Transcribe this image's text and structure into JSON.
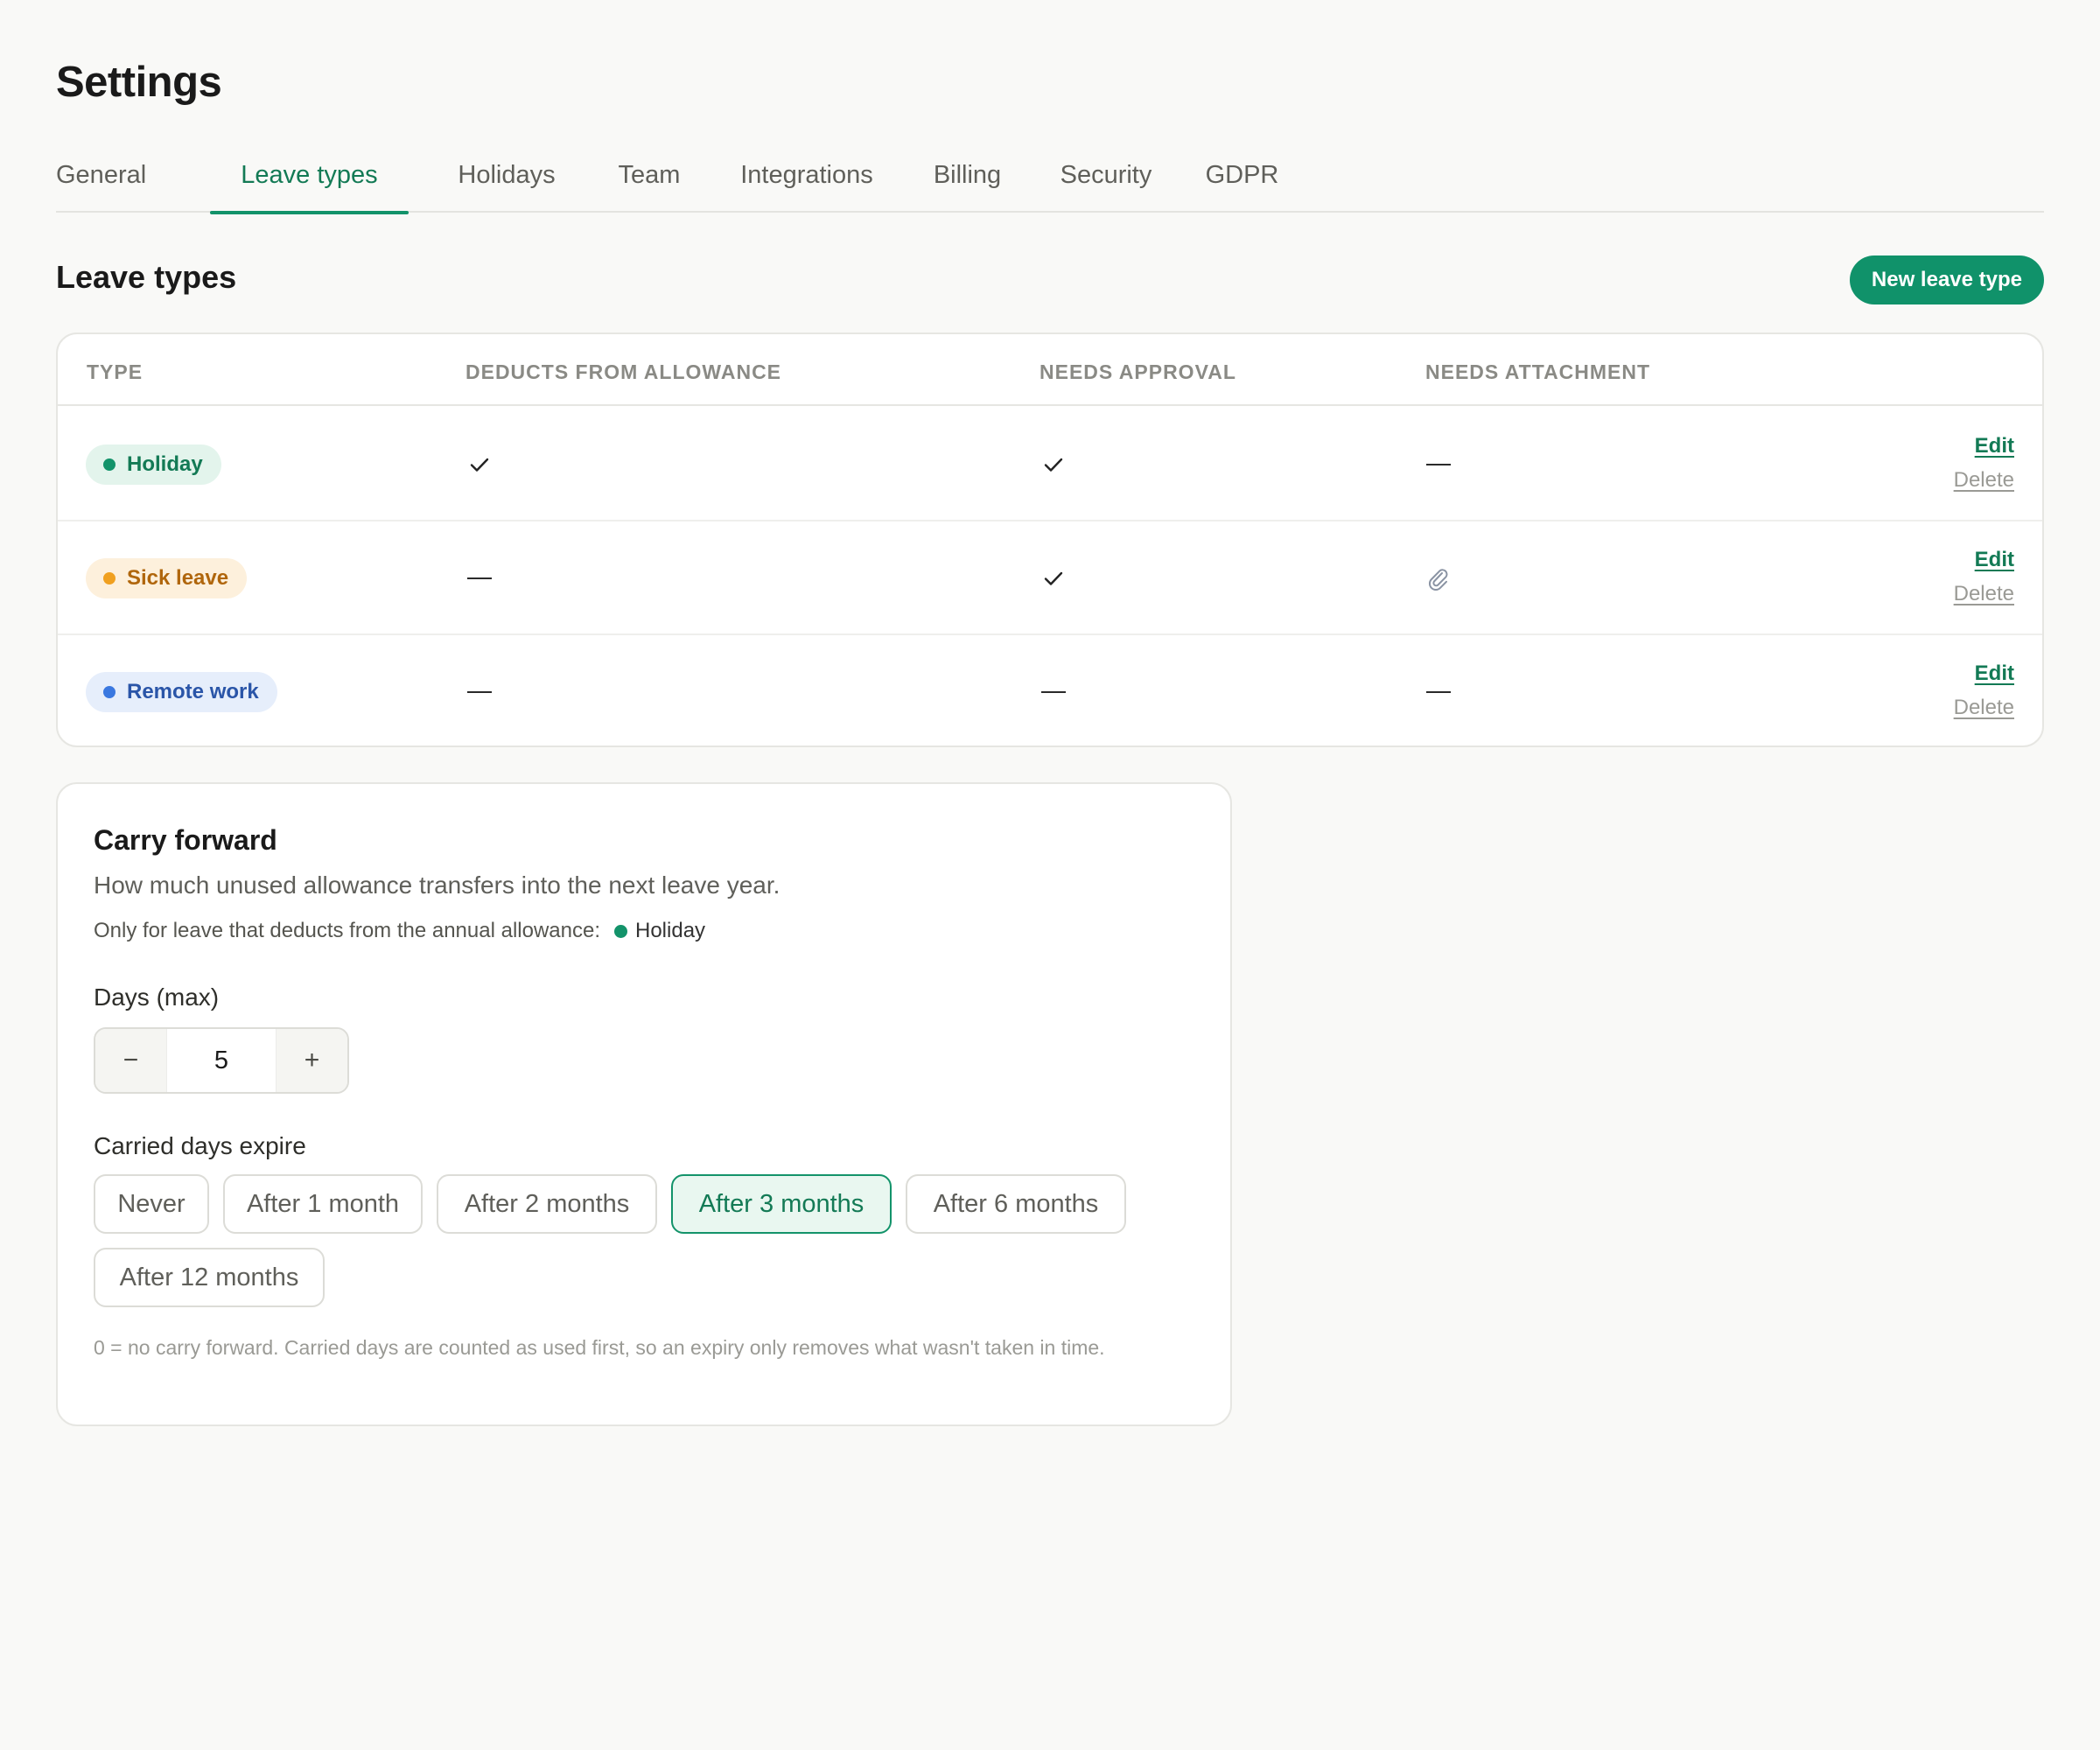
{
  "page": {
    "title": "Settings"
  },
  "tabs": [
    {
      "label": "General",
      "active": false
    },
    {
      "label": "Leave types",
      "active": true
    },
    {
      "label": "Holidays",
      "active": false
    },
    {
      "label": "Team",
      "active": false
    },
    {
      "label": "Integrations",
      "active": false
    },
    {
      "label": "Billing",
      "active": false
    },
    {
      "label": "Security",
      "active": false
    },
    {
      "label": "GDPR",
      "active": false
    }
  ],
  "leave_types": {
    "heading": "Leave types",
    "new_button": "New leave type",
    "columns": [
      "TYPE",
      "DEDUCTS FROM ALLOWANCE",
      "NEEDS APPROVAL",
      "NEEDS ATTACHMENT"
    ],
    "rows": [
      {
        "name": "Holiday",
        "color": "#13936a",
        "deducts": "check-icon",
        "approval": "check-icon",
        "attachment": "dash-icon",
        "edit": "Edit",
        "delete": "Delete"
      },
      {
        "name": "Sick leave",
        "color": "#f0a020",
        "deducts": "dash-icon",
        "approval": "check-icon",
        "attachment": "paperclip-icon",
        "edit": "Edit",
        "delete": "Delete"
      },
      {
        "name": "Remote work",
        "color": "#3a78e0",
        "deducts": "dash-icon",
        "approval": "dash-icon",
        "attachment": "dash-icon",
        "edit": "Edit",
        "delete": "Delete"
      }
    ]
  },
  "carry_forward": {
    "title": "Carry forward",
    "description": "How much unused allowance transfers into the next leave year.",
    "note": "Only for leave that deducts from the annual allowance:",
    "note_type": "Holiday",
    "days_label": "Days (max)",
    "days_value": "5",
    "minus_label": "−",
    "plus_label": "+",
    "expire_label": "Carried days expire",
    "expire_options": [
      "Never",
      "After 1 month",
      "After 2 months",
      "After 3 months",
      "After 6 months",
      "After 12 months"
    ],
    "expire_selected": "After 3 months",
    "help": "0 = no carry forward. Carried days are counted as used first, so an expiry only removes what wasn't taken in time."
  },
  "colors": {
    "accent": "#10926a",
    "accent_text": "#137a55",
    "sick": "#f0a020",
    "remote": "#3a78e0"
  }
}
